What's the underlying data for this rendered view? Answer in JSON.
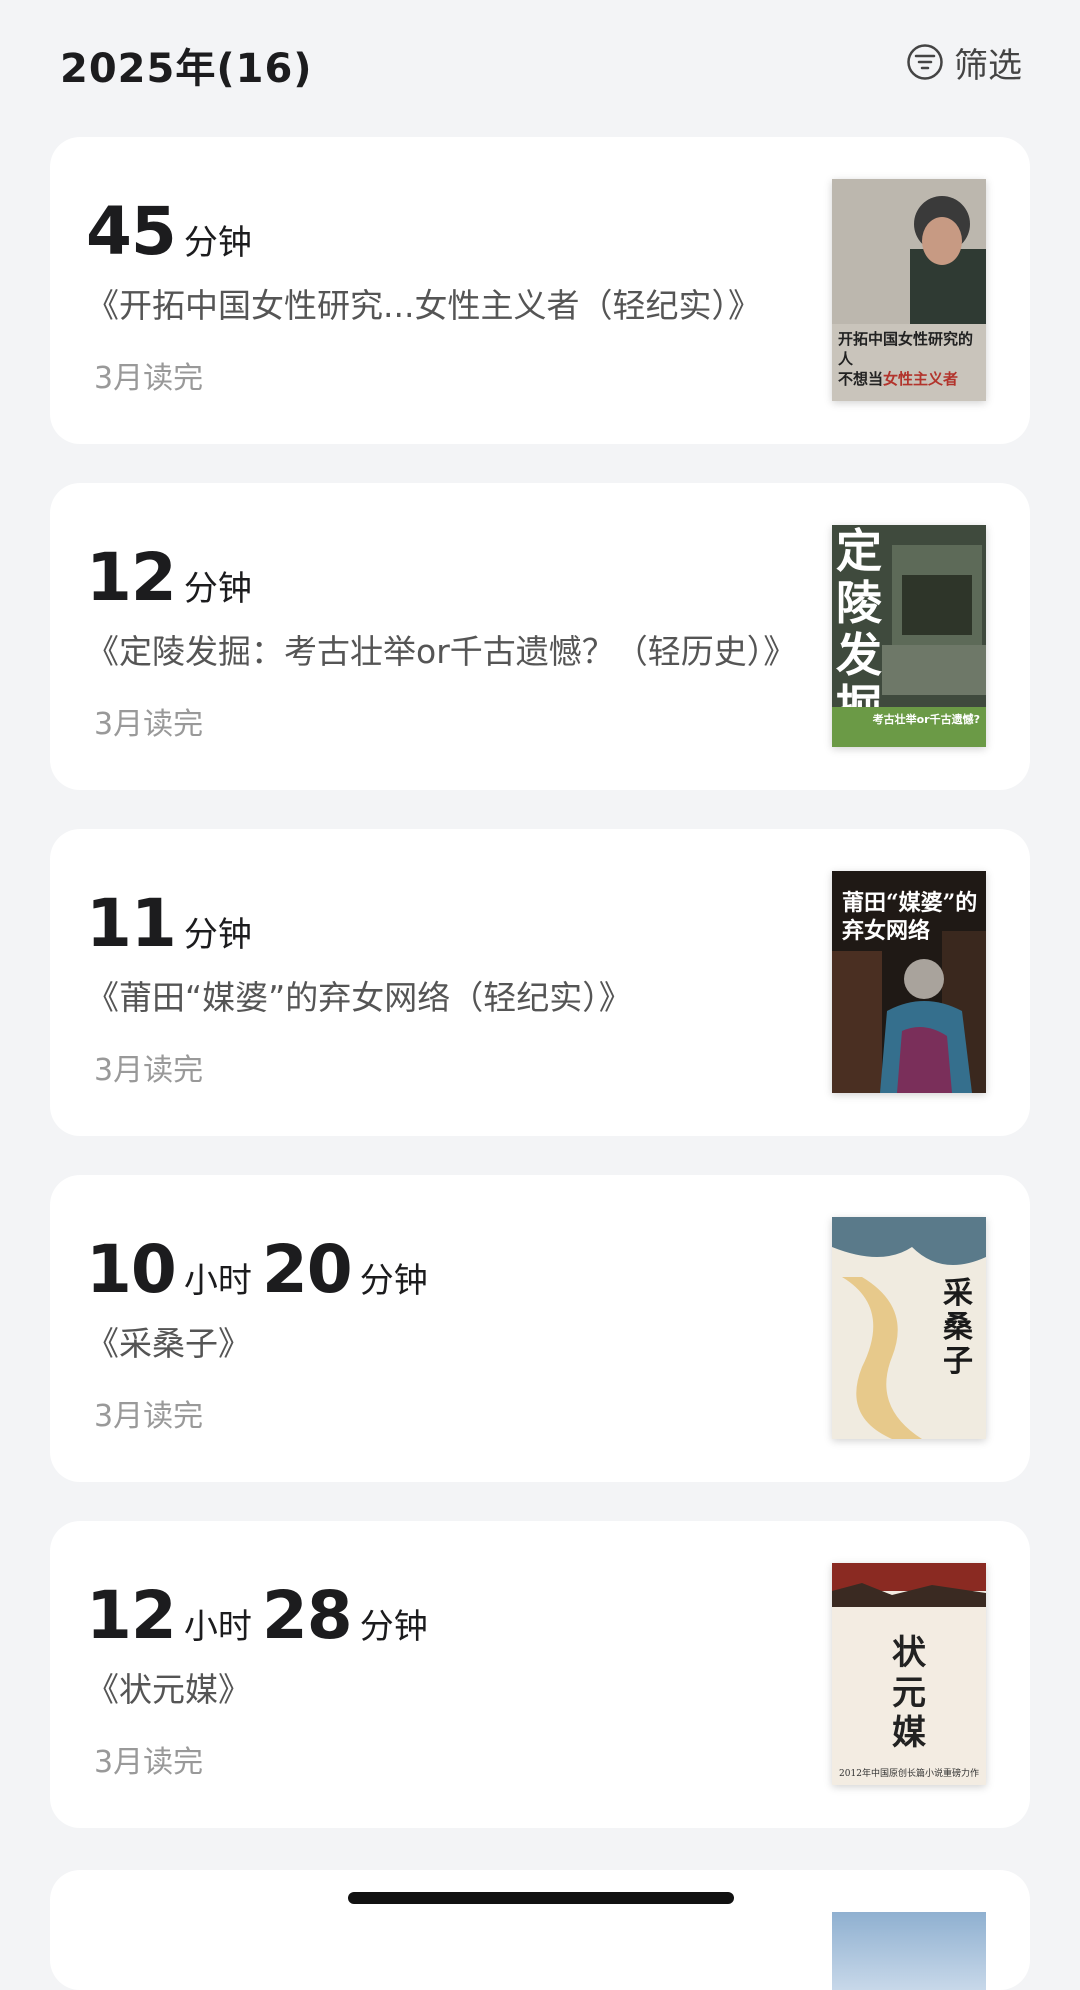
{
  "header": {
    "year_title": "2025年(16)",
    "filter_label": "筛选",
    "filter_icon": "filter-icon"
  },
  "books": [
    {
      "duration": [
        {
          "num": "45",
          "unit": "分钟"
        }
      ],
      "title": "《开拓中国女性研究...女性主义者（轻纪实）》",
      "status": "3月读完",
      "cover_text": "开拓中国女性研究的人",
      "cover_text_2": "不想当",
      "cover_text_hl": "女性主义者"
    },
    {
      "duration": [
        {
          "num": "12",
          "unit": "分钟"
        }
      ],
      "title": "《定陵发掘：考古壮举or千古遗憾？（轻历史）》",
      "status": "3月读完",
      "cover_text": "定陵发掘",
      "cover_sub": "考古壮举or千古遗憾?"
    },
    {
      "duration": [
        {
          "num": "11",
          "unit": "分钟"
        }
      ],
      "title": "《莆田“媒婆”的弃女网络（轻纪实）》",
      "status": "3月读完",
      "cover_text": "莆田“媒婆”的弃女网络"
    },
    {
      "duration": [
        {
          "num": "10",
          "unit": "小时"
        },
        {
          "num": "20",
          "unit": "分钟"
        }
      ],
      "title": "《采桑子》",
      "status": "3月读完",
      "cover_text": "采桑子"
    },
    {
      "duration": [
        {
          "num": "12",
          "unit": "小时"
        },
        {
          "num": "28",
          "unit": "分钟"
        }
      ],
      "title": "《状元媒》",
      "status": "3月读完",
      "cover_text": "状元媒",
      "cover_foot": "2012年中国原创长篇小说重磅力作"
    }
  ],
  "colors": {
    "background": "#f3f4f6",
    "card": "#ffffff",
    "title_text": "#555555",
    "status_text": "#999999"
  }
}
